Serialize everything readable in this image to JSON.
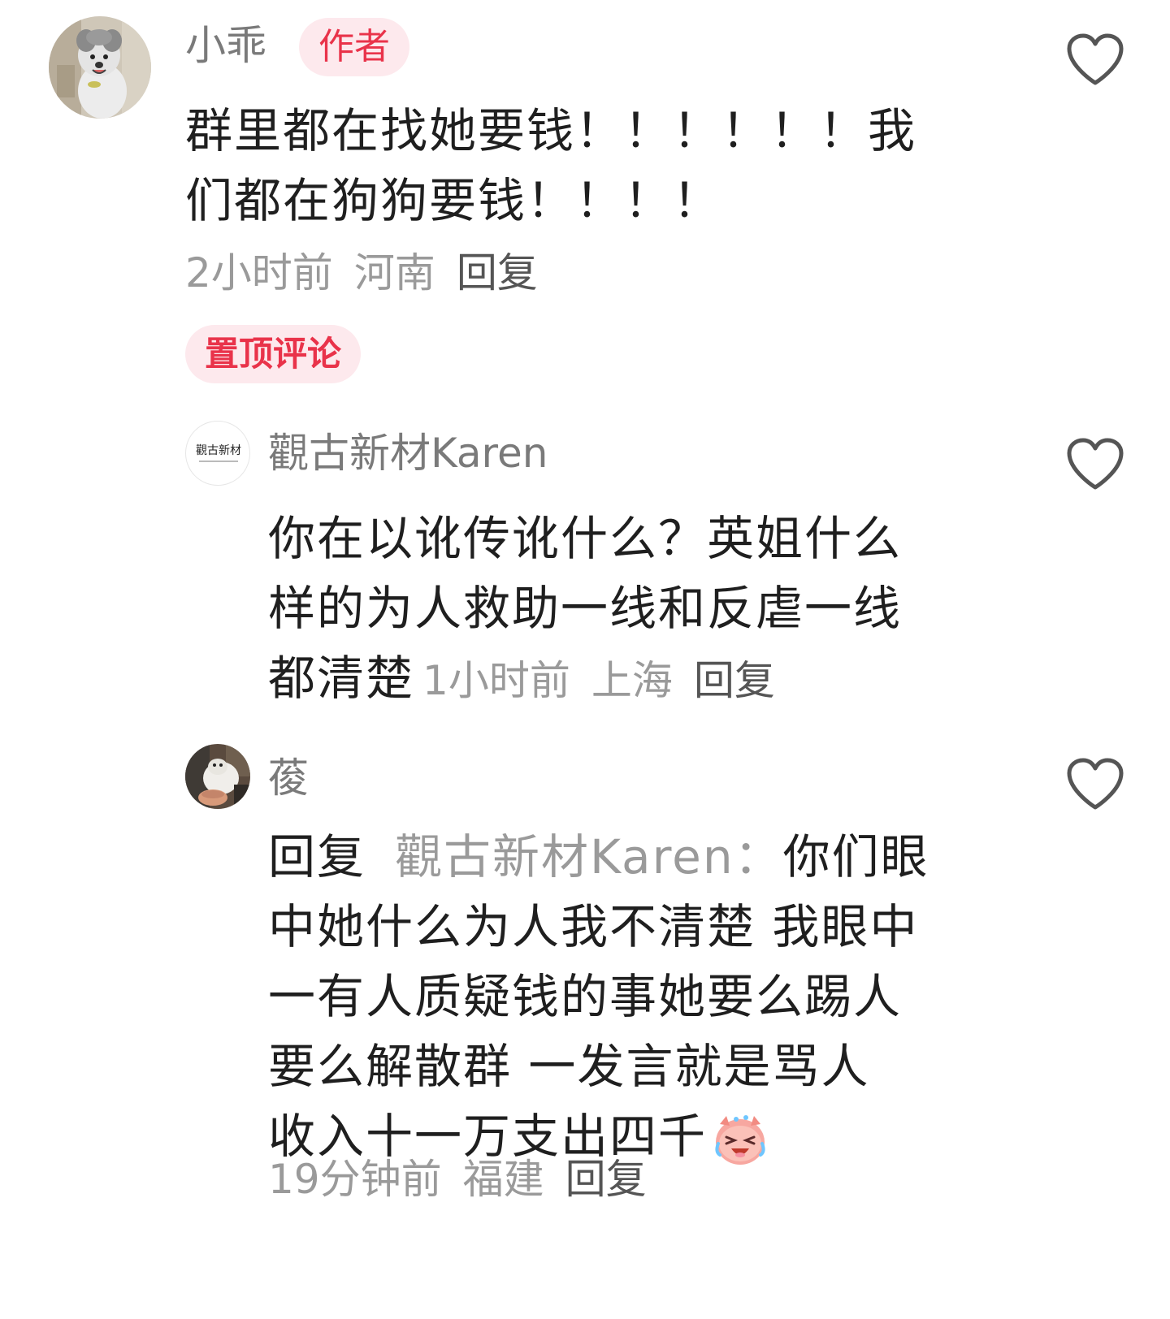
{
  "comments": [
    {
      "username": "小乖",
      "badge": "作者",
      "text_lines": [
        "群里都在找她要钱！！！！！！我",
        "们都在狗狗要钱！！！！"
      ],
      "time": "2小时前",
      "location": "河南",
      "reply_label": "回复",
      "pinned_label": "置顶评论",
      "avatar_icon": "poodle-dog-avatar"
    },
    {
      "username": "觀古新材Karen",
      "avatar_text": "觀古新材",
      "text_lines": [
        "你在以讹传讹什么？英姐什么",
        "样的为人救助一线和反虐一线",
        "都清楚"
      ],
      "time": "1小时前",
      "location": "上海",
      "reply_label": "回复"
    },
    {
      "username": "葰",
      "reply_prefix": "回复",
      "reply_target": "觀古新材Karen：",
      "text_first": "你们眼",
      "text_lines": [
        "中她什么为人我不清楚 我眼中",
        "一有人质疑钱的事她要么踢人",
        "要么解散群  一发言就是骂人",
        "收入十一万支出四千"
      ],
      "emoji_icon": "laughing-crying-emoji",
      "time": "19分钟前",
      "location": "福建",
      "reply_label": "回复",
      "avatar_icon": "cat-avatar"
    }
  ],
  "colors": {
    "accent": "#e9334a",
    "badge_bg": "#fde9ed",
    "meta": "#9a9a9a",
    "text": "#1f1f1f"
  }
}
